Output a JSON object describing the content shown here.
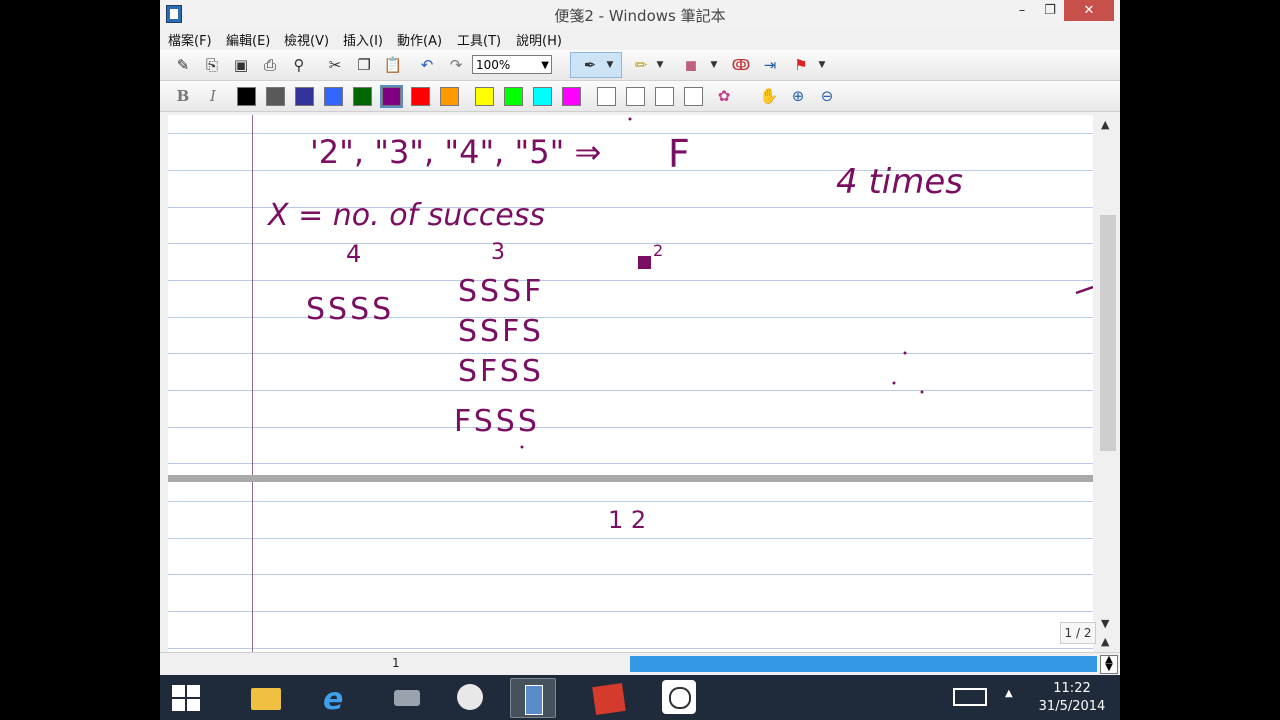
{
  "window": {
    "title": "便箋2 - Windows 筆記本",
    "min": "–",
    "max": "❐",
    "close": "✕"
  },
  "menu": [
    {
      "label": "檔案(F)"
    },
    {
      "label": "編輯(E)"
    },
    {
      "label": "檢視(V)"
    },
    {
      "label": "插入(I)"
    },
    {
      "label": "動作(A)"
    },
    {
      "label": "工具(T)"
    },
    {
      "label": "說明(H)"
    }
  ],
  "toolbar": {
    "zoom": "100%",
    "bold": "B",
    "italic": "I",
    "colors": [
      "#000000",
      "#595959",
      "#333399",
      "#3366ff",
      "#006600",
      "#800080",
      "#ff0000",
      "#ff9900",
      "#ffff00",
      "#00ff00",
      "#00ffff",
      "#ff00ff",
      "#ffffff",
      "#ffffff",
      "#ffffff",
      "#ffffff"
    ],
    "selected_color": "#800080",
    "icons": [
      "new-note-icon",
      "new-page-icon",
      "save-icon",
      "print-icon",
      "find-icon",
      "cut-icon",
      "copy-icon",
      "paste-icon",
      "undo-icon",
      "redo-icon",
      "pen-icon",
      "highlighter-icon",
      "eraser-icon",
      "lasso-icon",
      "insert-space-icon",
      "flag-icon",
      "color-wheel-icon",
      "pan-icon",
      "zoom-in-icon",
      "zoom-out-icon"
    ]
  },
  "notes": {
    "line1": "'2\", \"3\", \"4\", \"5\"  ⇒",
    "f_big": "F",
    "four_times": "4 times",
    "x_def": "X = no. of success",
    "col_four": "4",
    "col_three": "3",
    "sup_two": "2",
    "ssss": "SSSS",
    "perm1": "SSSF",
    "perm2": "SSFS",
    "perm3": "SFSS",
    "perm4": "FSSS",
    "page2_text": "1 2"
  },
  "page_indicator": "1 / 2",
  "status": {
    "page": "1"
  },
  "taskbar": {
    "apps": [
      "file-explorer-icon",
      "internet-explorer-icon",
      "network-tool-icon",
      "draw-tool-icon",
      "journal-icon",
      "presentation-icon",
      "geogebra-icon"
    ],
    "time": "11:22",
    "date": "31/5/2014"
  }
}
